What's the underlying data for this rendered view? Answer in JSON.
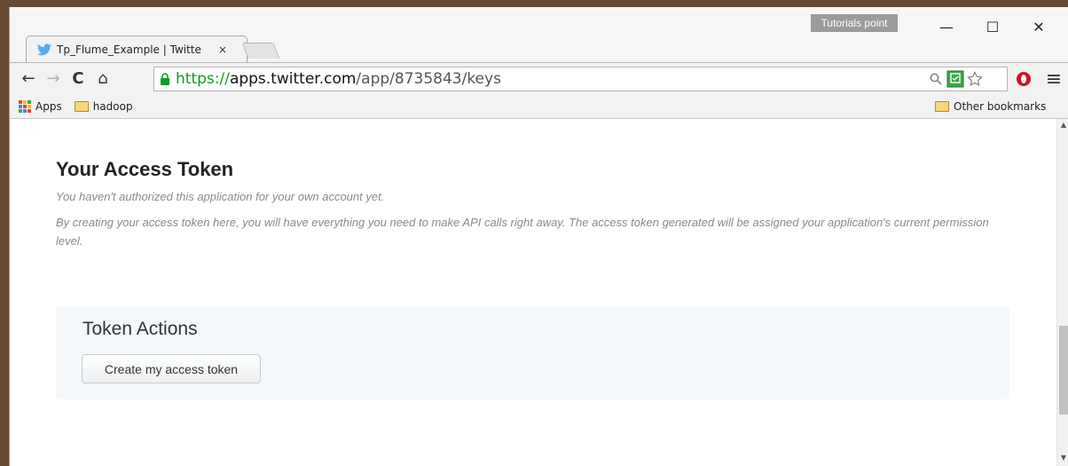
{
  "window": {
    "profile_badge": "Tutorials point",
    "controls": {
      "minimize": "—",
      "maximize": "☐",
      "close": "✕"
    }
  },
  "tab": {
    "title": "Tp_Flume_Example | Twitte",
    "close": "×",
    "icon": "twitter-bird-icon"
  },
  "toolbar": {
    "back": "←",
    "forward": "→",
    "reload": "C",
    "home": "⌂",
    "url_scheme": "https://",
    "url_host": "apps.twitter.com",
    "url_path": "/app/8735843/keys",
    "menu": "≡"
  },
  "bookmarks": {
    "apps_label": "Apps",
    "folder_label": "hadoop",
    "other_label": "Other bookmarks"
  },
  "page": {
    "heading": "Your Access Token",
    "note1": "You haven't authorized this application for your own account yet.",
    "note2": "By creating your access token here, you will have everything you need to make API calls right away. The access token generated will be assigned your application's current permission level.",
    "panel_title": "Token Actions",
    "button_label": "Create my access token"
  },
  "colors": {
    "secure_scheme": "#139a2b",
    "twitter_blue": "#55acee",
    "apps_grid": [
      "#ea4335",
      "#fbbc05",
      "#34a853",
      "#4285f4",
      "#ea4335",
      "#fbbc05",
      "#34a853",
      "#4285f4",
      "#ea4335"
    ]
  }
}
